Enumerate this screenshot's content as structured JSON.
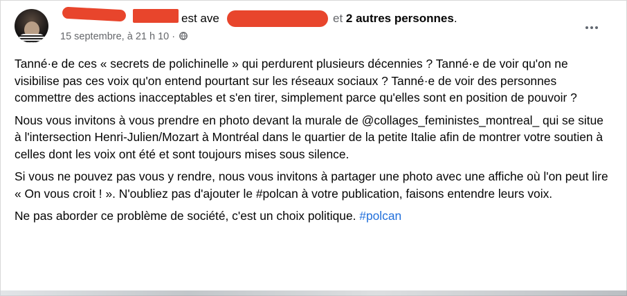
{
  "post": {
    "header": {
      "connector_text": "est ave",
      "suffix_text": "et",
      "others_text": "2 autres personnes",
      "period": "."
    },
    "timestamp": "15 septembre, à 21 h 10",
    "separator": "·",
    "audience_icon": "globe-icon",
    "more_icon": "more-horizontal-icon",
    "paragraphs": [
      "Tanné·e de ces « secrets de polichinelle » qui perdurent plusieurs décennies ? Tanné·e de voir qu'on ne visibilise pas ces voix qu'on entend pourtant sur les réseaux sociaux ? Tanné·e de voir des personnes commettre des actions inacceptables et s'en tirer, simplement parce qu'elles sont en position de pouvoir ?",
      "Nous vous invitons à vous prendre en photo devant la murale de @collages_feministes_montreal_ qui se situe à l'intersection Henri-Julien/Mozart à Montréal dans le quartier de la petite Italie afin de montrer votre soutien à celles dont les voix ont été et sont toujours mises sous silence.",
      "Si vous ne pouvez pas vous y rendre, nous vous invitons à partager une photo avec une affiche où l'on peut lire « On vous croit ! ». N'oubliez pas d'ajouter le #polcan à votre publication, faisons entendre leurs voix."
    ],
    "last_paragraph_text": "Ne pas aborder ce problème de société, c'est un choix politique.",
    "hashtag": "#polcan",
    "colors": {
      "redaction": "#e8452c",
      "hashtag": "#216fdb",
      "meta": "#65676b"
    }
  }
}
